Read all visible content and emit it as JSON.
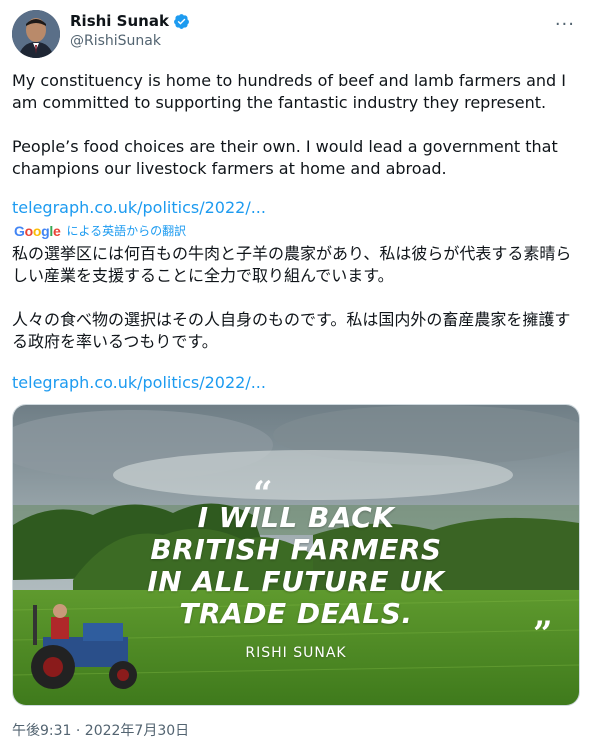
{
  "author": {
    "name": "Rishi Sunak",
    "handle": "@RishiSunak"
  },
  "tweet": {
    "paragraph1": "My constituency is home to hundreds of beef and lamb farmers and I am committed to supporting the fantastic industry they represent.",
    "paragraph2": "People’s food choices are their own. I would lead a government that champions our livestock farmers at home and abroad.",
    "link": "telegraph.co.uk/politics/2022/..."
  },
  "translation": {
    "logo_text": "Google",
    "label": "による英語からの翻訳",
    "paragraph1": "私の選挙区には何百もの牛肉と子羊の農家があり、私は彼らが代表する素晴らしい産業を支援することに全力で取り組んでいます。",
    "paragraph2": "人々の食べ物の選択はその人自身のものです。私は国内外の畜産農家を擁護する政府を率いるつもりです。",
    "link": "telegraph.co.uk/politics/2022/..."
  },
  "media": {
    "quote_lines": [
      "I WILL BACK",
      "BRITISH FARMERS",
      "IN ALL FUTURE UK",
      "TRADE DEALS."
    ],
    "attribution": "RISHI SUNAK"
  },
  "timestamp": "午後9:31 · 2022年7月30日",
  "colors": {
    "link": "#1d9bf0",
    "verified": "#1d9bf0",
    "secondary_text": "#536471"
  }
}
